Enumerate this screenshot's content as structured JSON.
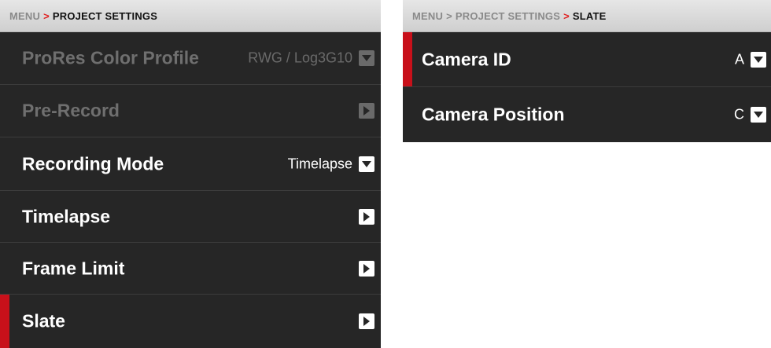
{
  "left_panel": {
    "breadcrumb": {
      "root": "MENU",
      "separator": ">",
      "current": "PROJECT SETTINGS"
    },
    "rows": [
      {
        "label": "ProRes Color Profile",
        "value": "RWG / Log3G10",
        "icon": "chevron-down-icon",
        "state": "disabled"
      },
      {
        "label": "Pre-Record",
        "value": "",
        "icon": "chevron-right-icon",
        "state": "disabled"
      },
      {
        "label": "Recording Mode",
        "value": "Timelapse",
        "icon": "chevron-down-icon",
        "state": "enabled"
      },
      {
        "label": "Timelapse",
        "value": "",
        "icon": "chevron-right-icon",
        "state": "enabled"
      },
      {
        "label": "Frame Limit",
        "value": "",
        "icon": "chevron-right-icon",
        "state": "enabled"
      },
      {
        "label": "Slate",
        "value": "",
        "icon": "chevron-right-icon",
        "state": "selected"
      }
    ]
  },
  "right_panel": {
    "breadcrumb": {
      "root": "MENU",
      "separator_1": ">",
      "middle": "PROJECT SETTINGS",
      "separator_2": ">",
      "current": "SLATE"
    },
    "rows": [
      {
        "label": "Camera ID",
        "value": "A",
        "icon": "chevron-down-icon",
        "state": "selected"
      },
      {
        "label": "Camera Position",
        "value": "C",
        "icon": "chevron-down-icon",
        "state": "enabled"
      }
    ]
  },
  "colors": {
    "panel_bg": "#262626",
    "header_bg": "#d9d9d9",
    "accent_red": "#c8101a",
    "text_enabled": "#ffffff",
    "text_disabled": "#6f6f6f"
  }
}
